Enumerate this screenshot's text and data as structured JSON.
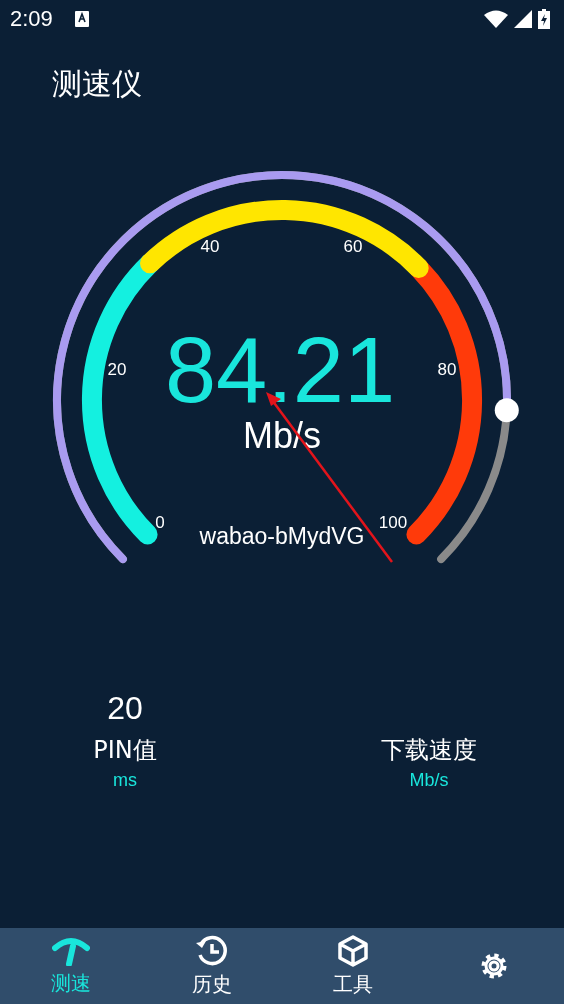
{
  "status_bar": {
    "time": "2:09"
  },
  "title": "测速仪",
  "gauge": {
    "value": "84.21",
    "unit": "Mb/s",
    "network": "wabao-bMydVG",
    "ticks": [
      "0",
      "20",
      "40",
      "60",
      "80",
      "100"
    ]
  },
  "stats": [
    {
      "value": "20",
      "label": "PIN值",
      "unit": "ms"
    },
    {
      "label": "下载速度",
      "unit": "Mb/s"
    }
  ],
  "tabs": [
    {
      "kind": "speed",
      "label": "测速",
      "selected": true
    },
    {
      "kind": "history",
      "label": "历史",
      "selected": false
    },
    {
      "kind": "tools",
      "label": "工具",
      "selected": false
    },
    {
      "kind": "settings",
      "selected": false
    }
  ]
}
